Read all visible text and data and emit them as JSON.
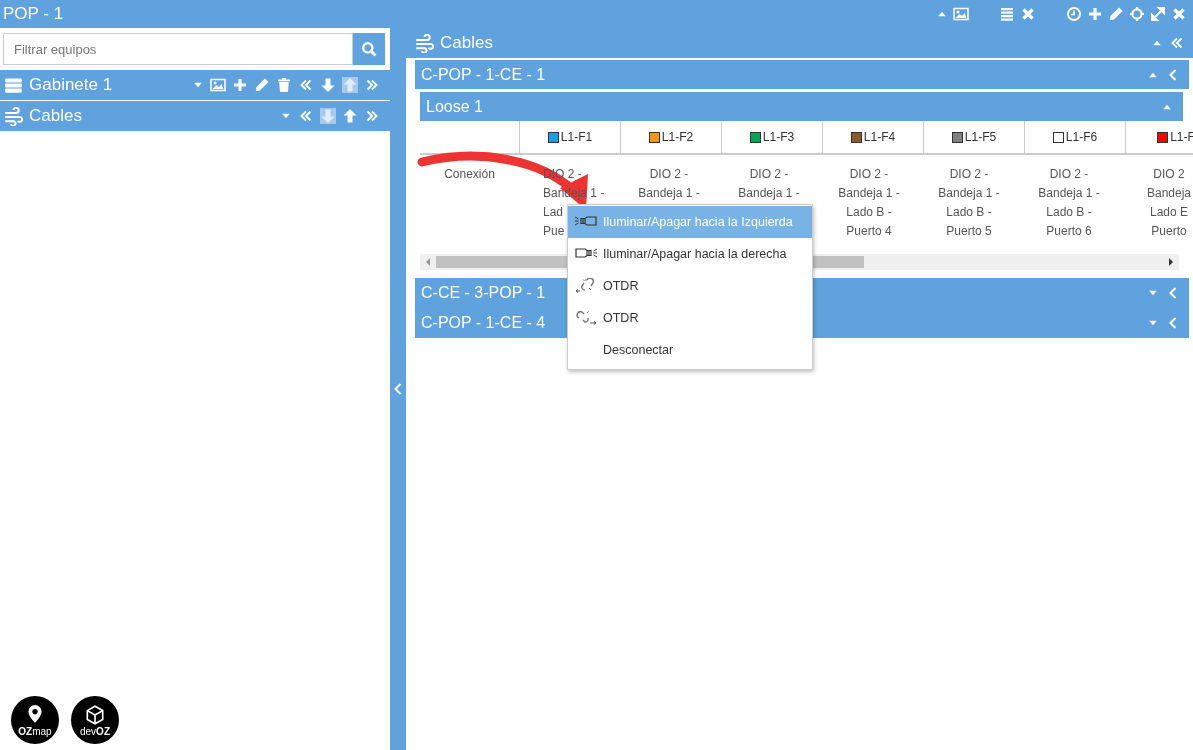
{
  "window": {
    "title": "POP - 1"
  },
  "sidebar": {
    "search": {
      "placeholder": "Filtrar equipos"
    },
    "sections": [
      {
        "kind": "cabinet",
        "title": "Gabinete 1",
        "can_move_up": false,
        "can_move_down": true
      },
      {
        "kind": "cables",
        "title": "Cables",
        "can_move_up": true,
        "can_move_down": false
      }
    ]
  },
  "logos": [
    {
      "kind": "pin",
      "text": "**OZ**map"
    },
    {
      "kind": "box",
      "text": "dev**OZ**"
    }
  ],
  "panel": {
    "title": "Cables",
    "cables": [
      {
        "title": "C-POP - 1-CE - 1",
        "expanded": true,
        "tubes": [
          {
            "title": "Loose 1",
            "expanded": true,
            "row_label": "Conexión",
            "fibers": [
              {
                "label": "L1-F1",
                "color": "#1e9de0",
                "connection": [
                  "DIO 2 -",
                  "Bandeja 1 -",
                  "Lad",
                  "Pue"
                ]
              },
              {
                "label": "L1-F2",
                "color": "#f7941d",
                "connection": [
                  "DIO 2 -",
                  "Bandeja 1 -"
                ]
              },
              {
                "label": "L1-F3",
                "color": "#00a651",
                "connection": [
                  "DIO 2 -",
                  "Bandeja 1 -"
                ]
              },
              {
                "label": "L1-F4",
                "color": "#8b5a2b",
                "connection": [
                  "DIO 2 -",
                  "Bandeja 1 -",
                  "Lado B -",
                  "Puerto 4"
                ]
              },
              {
                "label": "L1-F5",
                "color": "#808080",
                "connection": [
                  "DIO 2 -",
                  "Bandeja 1 -",
                  "Lado B -",
                  "Puerto 5"
                ]
              },
              {
                "label": "L1-F6",
                "color": "#ffffff",
                "connection": [
                  "DIO 2 -",
                  "Bandeja 1 -",
                  "Lado B -",
                  "Puerto 6"
                ]
              },
              {
                "label": "L1-F",
                "color": "#ff0000",
                "connection": [
                  "DIO 2",
                  "Bandeja",
                  "Lado E",
                  "Puerto"
                ]
              }
            ]
          }
        ]
      },
      {
        "title": "C-CE - 3-POP - 1",
        "expanded": false
      },
      {
        "title": "C-POP - 1-CE - 4",
        "expanded": false
      }
    ]
  },
  "context_menu": {
    "items": [
      {
        "kind": "light-left",
        "label": "Iluminar/Apagar hacia la Izquierda",
        "selected": true
      },
      {
        "kind": "light-right",
        "label": "Iluminar/Apagar hacia la derecha",
        "selected": false
      },
      {
        "kind": "otdr-left",
        "label": "OTDR",
        "selected": false
      },
      {
        "kind": "otdr-right",
        "label": "OTDR",
        "selected": false
      },
      {
        "kind": "plain",
        "label": "Desconectar",
        "selected": false
      }
    ]
  }
}
